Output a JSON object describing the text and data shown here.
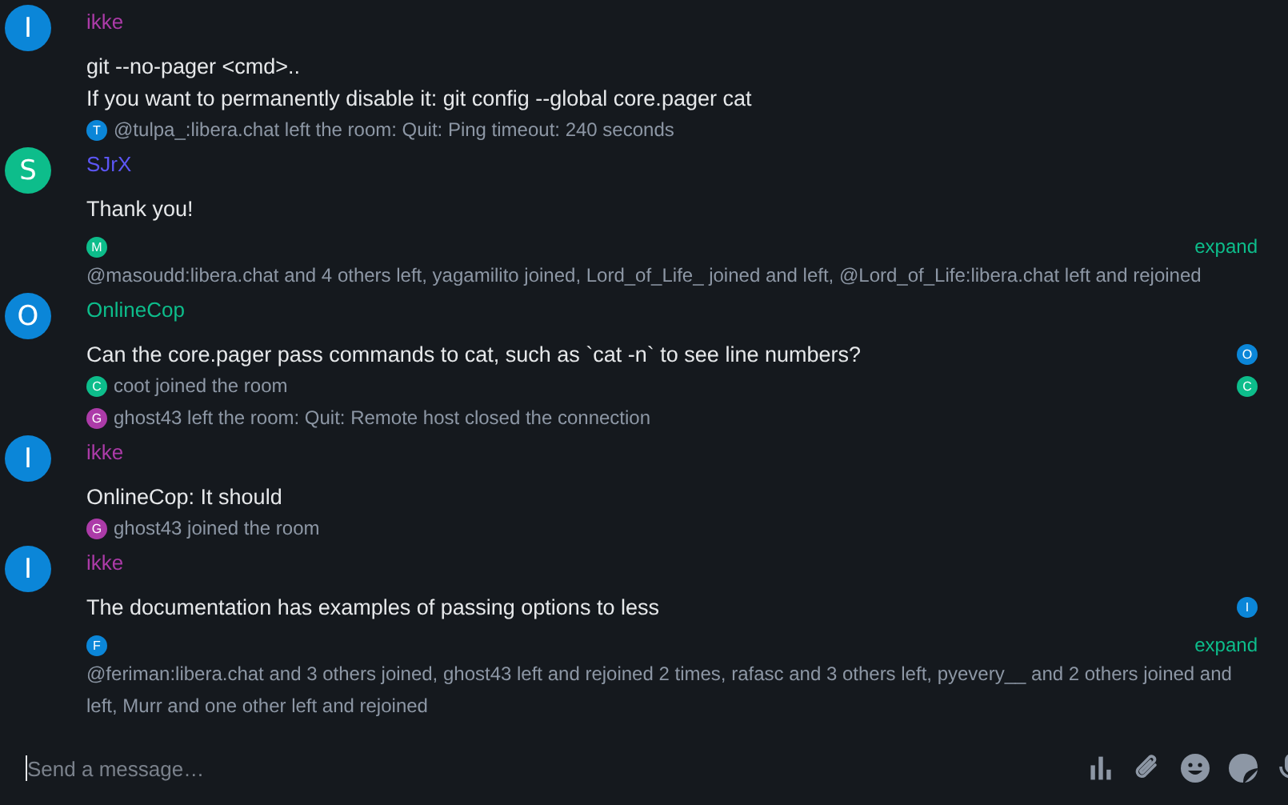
{
  "timeline": [
    {
      "sender": {
        "name": "ikke",
        "avatar": {
          "initial": "I",
          "color": "#0b86d8"
        },
        "color": "#ac3ba8"
      },
      "entries": [
        {
          "kind": "text",
          "text": "git --no-pager <cmd>.."
        },
        {
          "kind": "text",
          "text": "If you want to permanently disable it: git config --global core.pager cat"
        },
        {
          "kind": "event",
          "avatar": {
            "initial": "T",
            "color": "#0b86d8"
          },
          "text": "@tulpa_:libera.chat left the room: Quit: Ping timeout: 240 seconds"
        }
      ]
    },
    {
      "sender": {
        "name": "SJrX",
        "avatar": {
          "initial": "S",
          "color": "#0dbd8b"
        },
        "color": "#5c56f5"
      },
      "entries": [
        {
          "kind": "text",
          "text": "Thank you!"
        },
        {
          "kind": "summary",
          "avatars": [
            {
              "initial": "M",
              "color": "#0dbd8b"
            }
          ],
          "action": "expand",
          "text": "@masoudd:libera.chat and 4 others left, yagamilito joined, Lord_of_Life_ joined and left, @Lord_of_Life:libera.chat left and rejoined"
        }
      ]
    },
    {
      "sender": {
        "name": "OnlineCop",
        "avatar": {
          "initial": "O",
          "color": "#0b86d8"
        },
        "color": "#0dbd8b"
      },
      "entries": [
        {
          "kind": "text",
          "text": "Can the core.pager pass commands to cat, such as `cat -n` to see line numbers?",
          "receipt": {
            "initial": "O",
            "color": "#0b86d8"
          }
        },
        {
          "kind": "event",
          "avatar": {
            "initial": "C",
            "color": "#0dbd8b"
          },
          "text": "coot joined the room",
          "receipt": {
            "initial": "C",
            "color": "#0dbd8b"
          }
        },
        {
          "kind": "event",
          "avatar": {
            "initial": "G",
            "color": "#ac3ba8"
          },
          "text": "ghost43 left the room: Quit: Remote host closed the connection"
        }
      ]
    },
    {
      "sender": {
        "name": "ikke",
        "avatar": {
          "initial": "I",
          "color": "#0b86d8"
        },
        "color": "#ac3ba8"
      },
      "entries": [
        {
          "kind": "text",
          "text": "OnlineCop: It should"
        },
        {
          "kind": "event",
          "avatar": {
            "initial": "G",
            "color": "#ac3ba8"
          },
          "text": "ghost43 joined the room"
        }
      ]
    },
    {
      "sender": {
        "name": "ikke",
        "avatar": {
          "initial": "I",
          "color": "#0b86d8"
        },
        "color": "#ac3ba8"
      },
      "entries": [
        {
          "kind": "text",
          "text": "The documentation has examples of passing options to less",
          "receipt": {
            "initial": "I",
            "color": "#0b86d8"
          }
        },
        {
          "kind": "summary",
          "avatars": [
            {
              "initial": "F",
              "color": "#0b86d8"
            }
          ],
          "action": "expand",
          "text": "@feriman:libera.chat and 3 others joined, ghost43 left and rejoined 2 times, rafasc and 3 others left, pyevery__ and 2 others joined and left, Murr and one other left and rejoined"
        }
      ]
    }
  ],
  "composer": {
    "placeholder": "Send a message…"
  }
}
